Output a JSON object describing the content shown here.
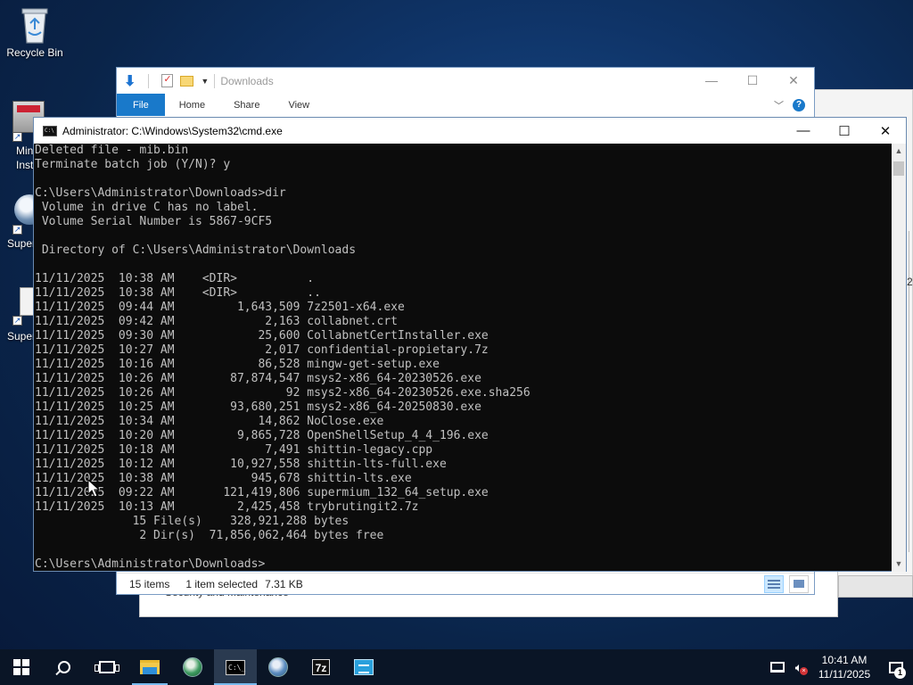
{
  "desktop": {
    "icons": [
      {
        "label": "Recycle Bin"
      },
      {
        "label_line1": "Min",
        "label_line2": "Inst"
      },
      {
        "label": "Super"
      },
      {
        "label": "Super"
      }
    ]
  },
  "explorer": {
    "title": "Downloads",
    "ribbon_tabs": [
      "File",
      "Home",
      "Share",
      "View"
    ],
    "status": {
      "item_count": "15 items",
      "selection": "1 item selected",
      "size": "7.31 KB"
    }
  },
  "background_window": {
    "text": "Security and Maintenance",
    "side_char": "2"
  },
  "cmd": {
    "title": "Administrator:  C:\\Windows\\System32\\cmd.exe",
    "lines": [
      "Deleted file - mib.bin",
      "Terminate batch job (Y/N)? y",
      "",
      "C:\\Users\\Administrator\\Downloads>dir",
      " Volume in drive C has no label.",
      " Volume Serial Number is 5867-9CF5",
      "",
      " Directory of C:\\Users\\Administrator\\Downloads",
      "",
      "11/11/2025  10:38 AM    <DIR>          .",
      "11/11/2025  10:38 AM    <DIR>          ..",
      "11/11/2025  09:44 AM         1,643,509 7z2501-x64.exe",
      "11/11/2025  09:42 AM             2,163 collabnet.crt",
      "11/11/2025  09:30 AM            25,600 CollabnetCertInstaller.exe",
      "11/11/2025  10:27 AM             2,017 confidential-propietary.7z",
      "11/11/2025  10:16 AM            86,528 mingw-get-setup.exe",
      "11/11/2025  10:26 AM        87,874,547 msys2-x86_64-20230526.exe",
      "11/11/2025  10:26 AM                92 msys2-x86_64-20230526.exe.sha256",
      "11/11/2025  10:25 AM        93,680,251 msys2-x86_64-20250830.exe",
      "11/11/2025  10:34 AM            14,862 NoClose.exe",
      "11/11/2025  10:20 AM         9,865,728 OpenShellSetup_4_4_196.exe",
      "11/11/2025  10:18 AM             7,491 shittin-legacy.cpp",
      "11/11/2025  10:12 AM        10,927,558 shittin-lts-full.exe",
      "11/11/2025  10:38 AM           945,678 shittin-lts.exe",
      "11/11/2025  09:22 AM       121,419,806 supermium_132_64_setup.exe",
      "11/11/2025  10:13 AM         2,425,458 trybrutingit2.7z",
      "              15 File(s)    328,921,288 bytes",
      "               2 Dir(s)  71,856,062,464 bytes free",
      "",
      "C:\\Users\\Administrator\\Downloads>"
    ]
  },
  "taskbar": {
    "pinned": [
      "start",
      "search",
      "task-view",
      "file-explorer",
      "supermium-browser",
      "command-prompt",
      "supermium-browser-2",
      "7-zip",
      "control-panel"
    ],
    "zip_label": "7z",
    "clock_time": "10:41 AM",
    "clock_date": "11/11/2025",
    "notification_count": "1"
  }
}
